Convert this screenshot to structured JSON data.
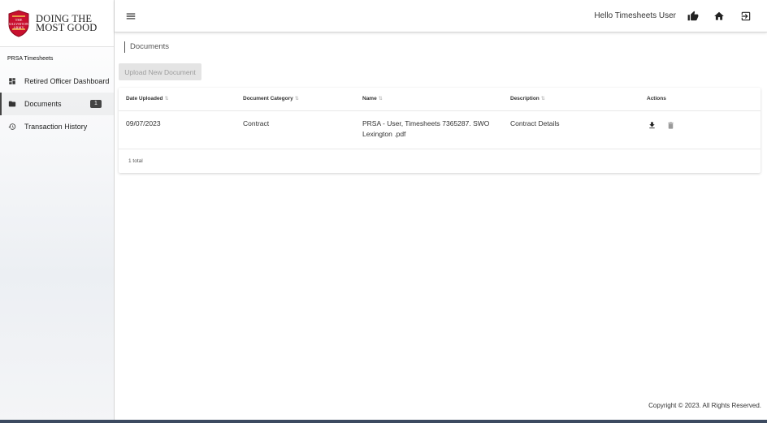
{
  "logo": {
    "emblem_text": "THE SALVATION ARMY",
    "line1": "DOING THE",
    "line2": "MOST GOOD",
    "brand_color": "#c8102e"
  },
  "sidebar": {
    "section_title": "PRSA Timesheets",
    "items": [
      {
        "label": "Retired Officer Dashboard",
        "icon": "dashboard-icon"
      },
      {
        "label": "Documents",
        "icon": "folder-icon",
        "badge": "1"
      },
      {
        "label": "Transaction History",
        "icon": "history-icon"
      }
    ]
  },
  "header": {
    "greeting": "Hello Timesheets User",
    "icons": [
      "menu-icon",
      "thumbs-up-icon",
      "home-icon",
      "logout-icon"
    ]
  },
  "breadcrumb": "Documents",
  "upload_label": "Upload New Document",
  "table": {
    "columns": [
      "Date Uploaded",
      "Document Category",
      "Name",
      "Description",
      "Actions"
    ],
    "rows": [
      {
        "date": "09/07/2023",
        "category": "Contract",
        "name_line1": "PRSA - User, Timesheets 7365287. SWO",
        "name_line2": "Lexington .pdf",
        "description": "Contract Details",
        "actions": [
          "download-icon",
          "delete-icon"
        ]
      }
    ],
    "total": "1 total"
  },
  "footer": "Copyright © 2023. All Rights Reserved."
}
